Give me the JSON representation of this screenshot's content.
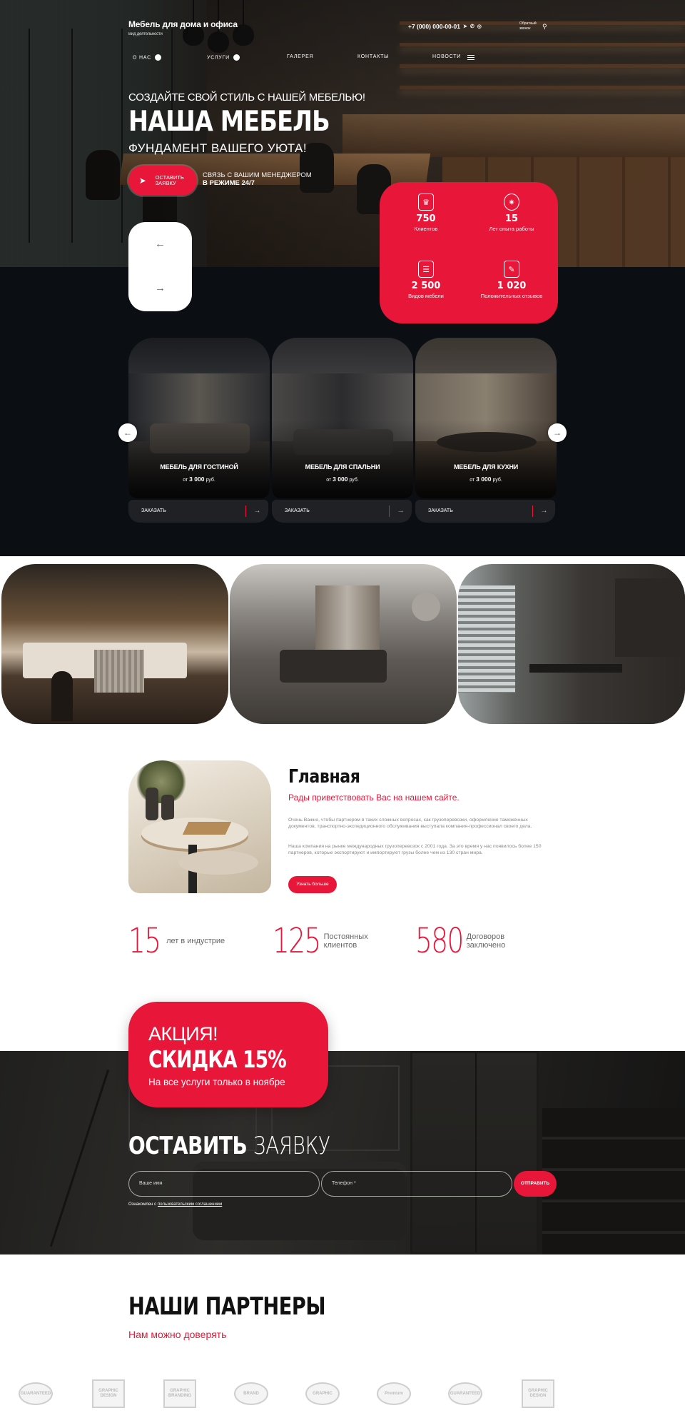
{
  "header": {
    "logo_title": "Мебель для дома и офиса",
    "logo_sub": "Вид деятельности",
    "phone": "+7 (000) 000-00-01",
    "callback": "Обратный звонок"
  },
  "nav": {
    "items": [
      "О НАС",
      "УСЛУГИ",
      "ГАЛЕРЕЯ",
      "КОНТАКТЫ",
      "НОВОСТИ"
    ]
  },
  "hero": {
    "pre": "СОЗДАЙТЕ СВОЙ СТИЛЬ С НАШЕЙ МЕБЕЛЬЮ!",
    "title": "НАША МЕБЕЛЬ",
    "sub": "ФУНДАМЕНТ ВАШЕГО УЮТА!",
    "cta_label": "ОСТАВИТЬ ЗАЯВКУ",
    "note_line1": "СВЯЗЬ С ВАШИМ МЕНЕДЖЕРОМ",
    "note_line2": "В РЕЖИМЕ 24/7"
  },
  "stats": [
    {
      "value": "750",
      "label": "Клиентов",
      "icon": "chef-hat-icon"
    },
    {
      "value": "15",
      "label": "Лет опыта работы",
      "icon": "badge-icon"
    },
    {
      "value": "2 500",
      "label": "Видов мебели",
      "icon": "cabinet-icon"
    },
    {
      "value": "1 020",
      "label": "Положительных отзывов",
      "icon": "review-icon"
    }
  ],
  "cards": [
    {
      "title": "МЕБЕЛЬ ДЛЯ ГОСТИНОЙ",
      "price_from": "от",
      "price": "3 000",
      "currency": "руб.",
      "order": "ЗАКАЗАТЬ"
    },
    {
      "title": "МЕБЕЛЬ ДЛЯ СПАЛЬНИ",
      "price_from": "от",
      "price": "3 000",
      "currency": "руб.",
      "order": "ЗАКАЗАТЬ"
    },
    {
      "title": "МЕБЕЛЬ ДЛЯ КУХНИ",
      "price_from": "от",
      "price": "3 000",
      "currency": "руб.",
      "order": "ЗАКАЗАТЬ"
    }
  ],
  "about": {
    "title": "Главная",
    "subtitle": "Рады приветствовать Вас на нашем сайте.",
    "p1": "Очень Важно, чтобы партнером в таких сложных вопросах, как грузоперевозки, оформление таможенных документов, транспортно-экспедиционного обслуживания выступала компания-профессионал своего дела.",
    "p2": "Наша компания на рынке международных грузоперевозок с 2001 года. За это время у нас появилось более 150 партнеров, которые экспортируют и импортируют грузы более чем из 130 стран мира.",
    "more": "Узнать больше"
  },
  "figures": [
    {
      "num": "15",
      "text": "лет в индустрие"
    },
    {
      "num": "125",
      "text": "Постоянных клиентов"
    },
    {
      "num": "580",
      "text": "Договоров заключено"
    }
  ],
  "promo": {
    "a1": "АКЦИЯ!",
    "a2": "СКИДКА 15%",
    "a3": "На все услуги только в ноябре"
  },
  "form": {
    "title_bold": "ОСТАВИТЬ",
    "title_light": "ЗАЯВКУ",
    "name_placeholder": "Ваше имя",
    "phone_placeholder": "Телефон *",
    "send": "ОТПРАВИТЬ",
    "agree_text": "Ознакомлен с",
    "agree_link": "пользовательским соглашением"
  },
  "partners": {
    "title": "НАШИ ПАРТНЕРЫ",
    "subtitle": "Нам можно доверять",
    "logos": [
      "GUARANTEED",
      "GRAPHIC DESIGN",
      "GRAPHIC BRANDING",
      "BRAND",
      "GRAPHIC",
      "Premium",
      "GUARANTEED",
      "GRAPHIC DESIGN"
    ]
  },
  "colors": {
    "accent": "#e8173a",
    "dark": "#0b0e12"
  }
}
